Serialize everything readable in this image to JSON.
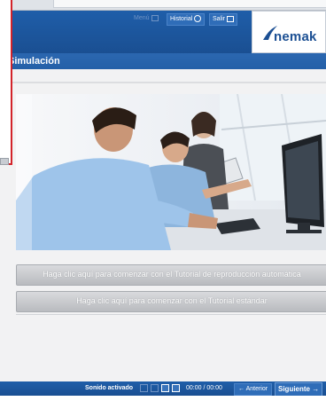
{
  "header": {
    "menu_label": "Menú",
    "historial_label": "Historial",
    "salir_label": "Salir",
    "logo_text": "nemak"
  },
  "title": {
    "text": "Simulación"
  },
  "content": {
    "photo_alt": "Personas trabajando en computadoras",
    "cta_auto": "Haga clic aquí para comenzar con el Tutorial de reproducción automática",
    "cta_standard": "Haga clic aquí para comenzar con el Tutorial estándar"
  },
  "footer": {
    "sound_label": "Sonido activado",
    "time_label": "00:00 / 00:00",
    "prev_label": "Anterior",
    "next_label": "Siguiente"
  },
  "colors": {
    "header_blue": "#1f5ea9",
    "accent_red": "#d3232a",
    "brand_blue": "#1b4f93"
  },
  "icons": [
    "menu-icon",
    "history-icon",
    "exit-icon",
    "arrow-left-icon",
    "arrow-right-icon"
  ]
}
